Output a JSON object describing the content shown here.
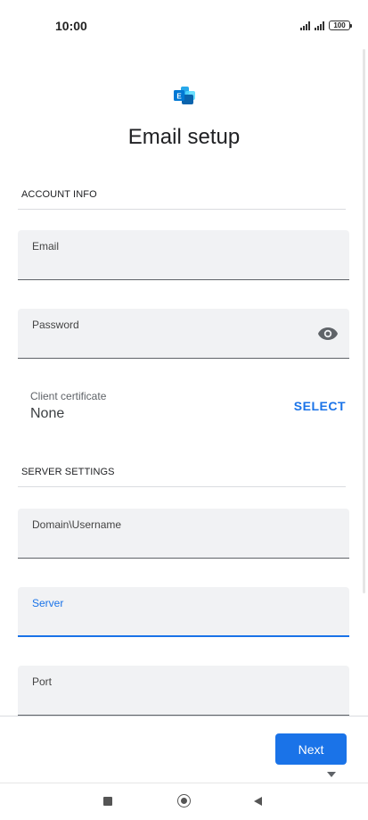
{
  "status_bar": {
    "time": "10:00",
    "battery": "100",
    "icons": [
      "signal-icon",
      "signal-icon",
      "battery-icon"
    ]
  },
  "header": {
    "logo_icon": "exchange-logo-icon",
    "title": "Email setup"
  },
  "account_info": {
    "section_title": "ACCOUNT INFO",
    "email": {
      "label": "Email",
      "value": ""
    },
    "password": {
      "label": "Password",
      "value": "",
      "toggle_icon": "eye-icon"
    },
    "client_certificate": {
      "label": "Client certificate",
      "value": "None",
      "action": "SELECT"
    }
  },
  "server_settings": {
    "section_title": "SERVER SETTINGS",
    "domain_username": {
      "label": "Domain\\Username",
      "value": ""
    },
    "server": {
      "label": "Server",
      "value": "",
      "focused": true
    },
    "port": {
      "label": "Port",
      "value": ""
    }
  },
  "actions": {
    "next_label": "Next",
    "more_icon": "chevron-down-icon"
  },
  "nav_bar": {
    "recents_icon": "square-icon",
    "home_icon": "circle-icon",
    "back_icon": "triangle-back-icon"
  },
  "colors": {
    "accent": "#1a73e8",
    "field_bg": "#f1f2f4"
  }
}
